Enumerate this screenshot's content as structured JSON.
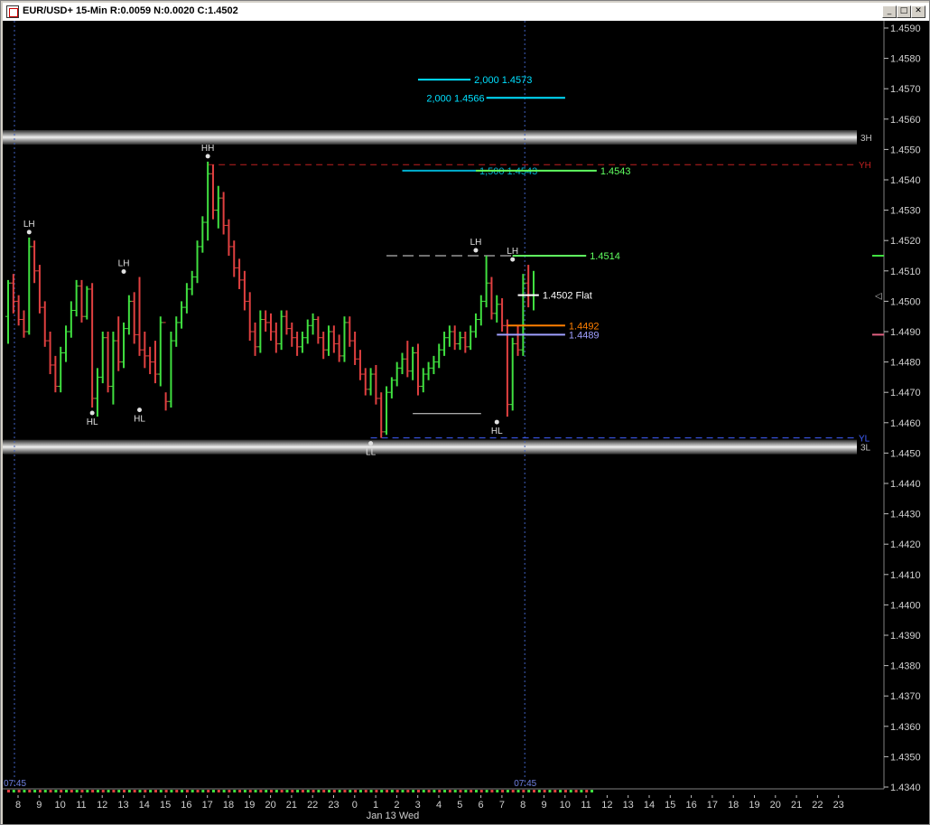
{
  "window": {
    "title": "EUR/USD+ 15-Min R:0.0059 N:0.0020 C:1.4502",
    "buttons": [
      "minimize",
      "maximize",
      "close"
    ]
  },
  "colors": {
    "background": "#000000",
    "up_bar": "#40e040",
    "down_bar": "#e04040",
    "cyan": "#00e0ff",
    "green_label": "#60ff60",
    "orange": "#ff7f00",
    "lavender": "#a0a0ff",
    "red_dash": "#c02020",
    "blue_dash": "#4060ff",
    "time_line": "#4060c0"
  },
  "chart_data": {
    "type": "bar",
    "symbol": "EUR/USD+",
    "interval": "15-Min",
    "stats": {
      "R": "0.0059",
      "N": "0.0020",
      "C": "1.4502"
    },
    "ylim": [
      1.434,
      1.4595
    ],
    "y_ticks": [
      "1.4590",
      "1.4580",
      "1.4570",
      "1.4560",
      "1.4550",
      "1.4540",
      "1.4530",
      "1.4520",
      "1.4510",
      "1.4500",
      "1.4490",
      "1.4480",
      "1.4470",
      "1.4460",
      "1.4450",
      "1.4440",
      "1.4430",
      "1.4420",
      "1.4410",
      "1.4400",
      "1.4390",
      "1.4380",
      "1.4370",
      "1.4360",
      "1.4350",
      "1.4340"
    ],
    "x_ticks": [
      "8",
      "9",
      "10",
      "11",
      "12",
      "13",
      "14",
      "15",
      "16",
      "17",
      "18",
      "19",
      "20",
      "21",
      "22",
      "23",
      "0",
      "1",
      "2",
      "3",
      "4",
      "5",
      "6",
      "7",
      "8",
      "9",
      "10",
      "11",
      "12",
      "13",
      "14",
      "15",
      "16",
      "17",
      "18",
      "19",
      "20",
      "21",
      "22",
      "23"
    ],
    "date_label": "Jan 13 Wed",
    "time_markers": [
      {
        "hour_index": 0,
        "label": "07:45"
      },
      {
        "hour_index": 24,
        "label": "07:45"
      }
    ],
    "grid": false,
    "ohlc": [
      [
        1.4495,
        1.4507,
        1.4486,
        1.4506
      ],
      [
        1.4506,
        1.4509,
        1.4496,
        1.45
      ],
      [
        1.45,
        1.4502,
        1.4492,
        1.4494
      ],
      [
        1.4494,
        1.4497,
        1.4488,
        1.449
      ],
      [
        1.449,
        1.4521,
        1.4489,
        1.4518
      ],
      [
        1.4518,
        1.452,
        1.4506,
        1.451
      ],
      [
        1.451,
        1.4512,
        1.4496,
        1.4498
      ],
      [
        1.4498,
        1.45,
        1.4485,
        1.4487
      ],
      [
        1.4487,
        1.449,
        1.4476,
        1.4479
      ],
      [
        1.4479,
        1.4482,
        1.447,
        1.4472
      ],
      [
        1.4472,
        1.4485,
        1.447,
        1.4483
      ],
      [
        1.4483,
        1.4492,
        1.448,
        1.449
      ],
      [
        1.449,
        1.45,
        1.4488,
        1.4497
      ],
      [
        1.4497,
        1.4507,
        1.4495,
        1.4505
      ],
      [
        1.4505,
        1.4507,
        1.4493,
        1.4495
      ],
      [
        1.4495,
        1.4505,
        1.4494,
        1.4504
      ],
      [
        1.4504,
        1.4506,
        1.4465,
        1.4468
      ],
      [
        1.4468,
        1.4478,
        1.4462,
        1.4475
      ],
      [
        1.4475,
        1.449,
        1.4473,
        1.4488
      ],
      [
        1.4488,
        1.449,
        1.447,
        1.4472
      ],
      [
        1.4472,
        1.449,
        1.4466,
        1.4487
      ],
      [
        1.4487,
        1.4495,
        1.4477,
        1.448
      ],
      [
        1.448,
        1.4493,
        1.4478,
        1.4491
      ],
      [
        1.4491,
        1.4502,
        1.4489,
        1.45
      ],
      [
        1.45,
        1.4503,
        1.4486,
        1.4489
      ],
      [
        1.4489,
        1.4508,
        1.4482,
        1.4484
      ],
      [
        1.4484,
        1.449,
        1.4478,
        1.4482
      ],
      [
        1.4482,
        1.4485,
        1.4476,
        1.448
      ],
      [
        1.448,
        1.4487,
        1.4473,
        1.4476
      ],
      [
        1.4476,
        1.4495,
        1.4472,
        1.4493
      ],
      [
        1.4493,
        1.447,
        1.4464,
        1.4467
      ],
      [
        1.4467,
        1.449,
        1.4465,
        1.4487
      ],
      [
        1.4487,
        1.4495,
        1.4485,
        1.4493
      ],
      [
        1.4493,
        1.45,
        1.4491,
        1.4498
      ],
      [
        1.4498,
        1.4506,
        1.4496,
        1.4504
      ],
      [
        1.4504,
        1.451,
        1.4502,
        1.4508
      ],
      [
        1.4508,
        1.452,
        1.4506,
        1.4518
      ],
      [
        1.4518,
        1.4528,
        1.4516,
        1.4526
      ],
      [
        1.4526,
        1.4546,
        1.452,
        1.4542
      ],
      [
        1.4542,
        1.4545,
        1.4527,
        1.453
      ],
      [
        1.453,
        1.4538,
        1.4524,
        1.4534
      ],
      [
        1.4534,
        1.4536,
        1.4522,
        1.4525
      ],
      [
        1.4525,
        1.4527,
        1.4515,
        1.4518
      ],
      [
        1.4518,
        1.452,
        1.4508,
        1.4511
      ],
      [
        1.4511,
        1.4514,
        1.4504,
        1.4507
      ],
      [
        1.4507,
        1.451,
        1.4497,
        1.45
      ],
      [
        1.45,
        1.4503,
        1.4487,
        1.449
      ],
      [
        1.449,
        1.4493,
        1.4482,
        1.4485
      ],
      [
        1.4485,
        1.4497,
        1.4483,
        1.4494
      ],
      [
        1.4494,
        1.4497,
        1.449,
        1.4493
      ],
      [
        1.4493,
        1.4496,
        1.4487,
        1.449
      ],
      [
        1.449,
        1.4493,
        1.4483,
        1.4486
      ],
      [
        1.4486,
        1.4497,
        1.4484,
        1.4495
      ],
      [
        1.4495,
        1.4497,
        1.4489,
        1.4491
      ],
      [
        1.4491,
        1.4493,
        1.4485,
        1.4488
      ],
      [
        1.4488,
        1.449,
        1.4482,
        1.4485
      ],
      [
        1.4485,
        1.449,
        1.4483,
        1.4488
      ],
      [
        1.4488,
        1.4494,
        1.4486,
        1.4492
      ],
      [
        1.4492,
        1.4496,
        1.4489,
        1.4494
      ],
      [
        1.4494,
        1.4495,
        1.4486,
        1.4488
      ],
      [
        1.4488,
        1.449,
        1.4481,
        1.4484
      ],
      [
        1.4484,
        1.4492,
        1.4482,
        1.449
      ],
      [
        1.449,
        1.4492,
        1.4483,
        1.4486
      ],
      [
        1.4486,
        1.4489,
        1.448,
        1.4482
      ],
      [
        1.4482,
        1.4495,
        1.448,
        1.4493
      ],
      [
        1.4493,
        1.4495,
        1.4485,
        1.4487
      ],
      [
        1.4487,
        1.449,
        1.4479,
        1.4481
      ],
      [
        1.4481,
        1.4484,
        1.4474,
        1.4476
      ],
      [
        1.4476,
        1.4478,
        1.4469,
        1.4471
      ],
      [
        1.4471,
        1.4478,
        1.4469,
        1.4476
      ],
      [
        1.4476,
        1.4479,
        1.4466,
        1.4468
      ],
      [
        1.4468,
        1.447,
        1.4455,
        1.4457
      ],
      [
        1.4457,
        1.4472,
        1.4456,
        1.447
      ],
      [
        1.447,
        1.4475,
        1.4468,
        1.4474
      ],
      [
        1.4474,
        1.448,
        1.4472,
        1.4478
      ],
      [
        1.4478,
        1.4483,
        1.4476,
        1.4481
      ],
      [
        1.4481,
        1.4487,
        1.4475,
        1.4477
      ],
      [
        1.4477,
        1.4485,
        1.4474,
        1.4483
      ],
      [
        1.4483,
        1.4486,
        1.4469,
        1.4472
      ],
      [
        1.4472,
        1.4478,
        1.447,
        1.4476
      ],
      [
        1.4476,
        1.448,
        1.4474,
        1.4478
      ],
      [
        1.4478,
        1.4482,
        1.4476,
        1.448
      ],
      [
        1.448,
        1.4486,
        1.4478,
        1.4484
      ],
      [
        1.4484,
        1.449,
        1.4482,
        1.4488
      ],
      [
        1.4488,
        1.4492,
        1.4485,
        1.449
      ],
      [
        1.449,
        1.4492,
        1.4484,
        1.4486
      ],
      [
        1.4486,
        1.449,
        1.4484,
        1.4488
      ],
      [
        1.4488,
        1.449,
        1.4483,
        1.4485
      ],
      [
        1.4485,
        1.4492,
        1.4484,
        1.449
      ],
      [
        1.449,
        1.4496,
        1.4488,
        1.4494
      ],
      [
        1.4494,
        1.4502,
        1.4492,
        1.45
      ],
      [
        1.45,
        1.4515,
        1.4498,
        1.4506
      ],
      [
        1.4506,
        1.4508,
        1.4494,
        1.4496
      ],
      [
        1.4496,
        1.4502,
        1.4493,
        1.4499
      ],
      [
        1.4499,
        1.4501,
        1.449,
        1.4492
      ],
      [
        1.4492,
        1.4494,
        1.4462,
        1.4466
      ],
      [
        1.4466,
        1.4488,
        1.4464,
        1.4486
      ],
      [
        1.4486,
        1.4492,
        1.4482,
        1.4484
      ],
      [
        1.4484,
        1.4509,
        1.4482,
        1.4506
      ],
      [
        1.4506,
        1.4512,
        1.4498,
        1.4502
      ],
      [
        1.4502,
        1.451,
        1.4497,
        1.4502
      ]
    ],
    "annotations": [
      {
        "label": "LH",
        "bar": 4,
        "price": 1.4521,
        "pos": "above"
      },
      {
        "label": "HL",
        "bar": 16,
        "price": 1.4465,
        "pos": "below"
      },
      {
        "label": "LH",
        "bar": 22,
        "price": 1.4508,
        "pos": "above"
      },
      {
        "label": "HL",
        "bar": 25,
        "price": 1.4466,
        "pos": "below"
      },
      {
        "label": "HH",
        "bar": 38,
        "price": 1.4546,
        "pos": "above"
      },
      {
        "label": "LL",
        "bar": 69,
        "price": 1.4455,
        "pos": "below"
      },
      {
        "label": "LH",
        "bar": 89,
        "price": 1.4515,
        "pos": "above"
      },
      {
        "label": "HL",
        "bar": 93,
        "price": 1.4462,
        "pos": "below"
      },
      {
        "label": "LH",
        "bar": 96,
        "price": 1.4512,
        "pos": "above"
      }
    ],
    "bands": [
      {
        "price": 1.4554,
        "label": "3H"
      },
      {
        "price": 1.4452,
        "label": "3L"
      }
    ],
    "dashed_levels": [
      {
        "price": 1.4545,
        "label": "YH",
        "color": "#c02020",
        "from_bar": 38
      },
      {
        "price": 1.4455,
        "label": "YL",
        "color": "#4060ff",
        "from_bar": 69
      }
    ],
    "projections": [
      {
        "text": "2,000  1.4573",
        "price": 1.4573,
        "from_bar": 78,
        "to_bar": 88,
        "color": "#00e0ff",
        "label_side": "end"
      },
      {
        "text": "2,000  1.4566",
        "price": 1.4567,
        "from_bar": 91,
        "to_bar": 106,
        "color": "#00e0ff",
        "label_side": "start"
      },
      {
        "text": "1,500  1.4543",
        "price": 1.4543,
        "from_bar": 75,
        "to_bar": 89,
        "color": "#00b0d0",
        "label_side": "end"
      },
      {
        "text": "1.4543",
        "price": 1.4543,
        "from_bar": 89,
        "to_bar": 112,
        "color": "#60ff60",
        "label_side": "end"
      },
      {
        "text": "1.4514",
        "price": 1.4515,
        "from_bar": 96,
        "to_bar": 110,
        "color": "#60ff60",
        "label_side": "end"
      },
      {
        "text": "1.4502 Flat",
        "price": 1.4502,
        "from_bar": 97,
        "to_bar": 101,
        "color": "#ffffff",
        "label_side": "end"
      },
      {
        "text": "1.4492",
        "price": 1.4492,
        "from_bar": 95,
        "to_bar": 106,
        "color": "#ff7f00",
        "label_side": "end"
      },
      {
        "text": "1.4489",
        "price": 1.4489,
        "from_bar": 93,
        "to_bar": 106,
        "color": "#a0a0ff",
        "label_side": "end"
      }
    ],
    "white_lines": [
      {
        "price": 1.4515,
        "from_bar": 72,
        "to_bar": 98,
        "dashed": true
      },
      {
        "price": 1.4463,
        "from_bar": 77,
        "to_bar": 90,
        "dashed": false
      }
    ]
  }
}
